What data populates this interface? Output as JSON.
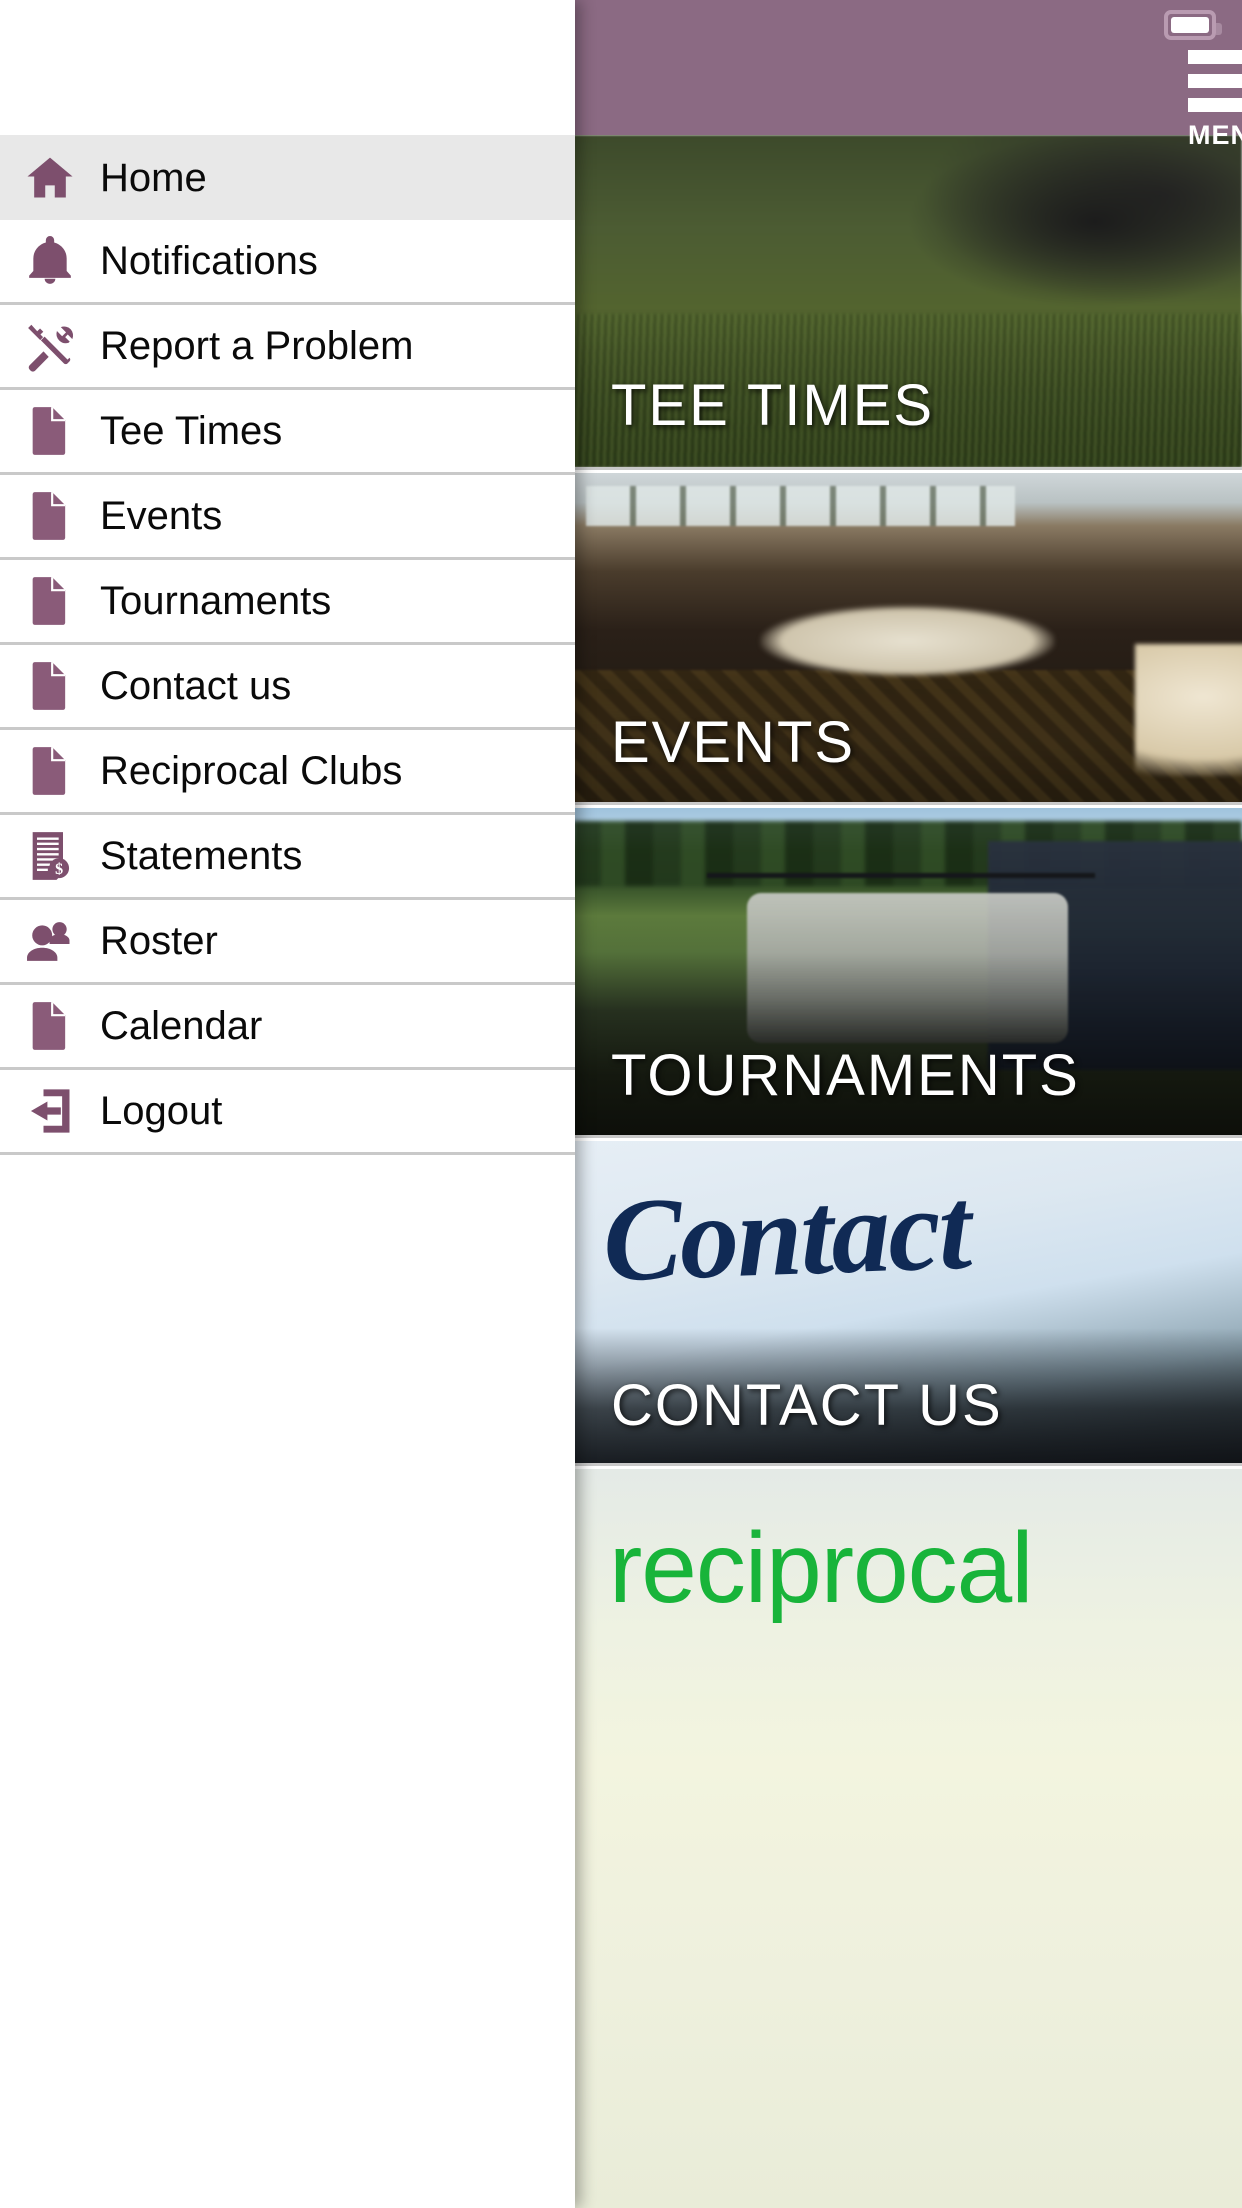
{
  "accent_color": "#8b6a83",
  "header": {
    "menu_label": "MENU",
    "hamburger_icon": "hamburger-menu-icon",
    "battery_icon": "battery-full-icon"
  },
  "drawer": {
    "items": [
      {
        "label": "Home",
        "icon": "home-icon",
        "active": true
      },
      {
        "label": "Notifications",
        "icon": "bell-icon",
        "active": false
      },
      {
        "label": "Report a Problem",
        "icon": "tools-icon",
        "active": false
      },
      {
        "label": "Tee Times",
        "icon": "document-icon",
        "active": false
      },
      {
        "label": "Events",
        "icon": "document-icon",
        "active": false
      },
      {
        "label": "Tournaments",
        "icon": "document-icon",
        "active": false
      },
      {
        "label": "Contact us",
        "icon": "document-icon",
        "active": false
      },
      {
        "label": "Reciprocal Clubs",
        "icon": "document-icon",
        "active": false
      },
      {
        "label": "Statements",
        "icon": "invoice-dollar-icon",
        "active": false
      },
      {
        "label": "Roster",
        "icon": "people-icon",
        "active": false
      },
      {
        "label": "Calendar",
        "icon": "document-icon",
        "active": false
      },
      {
        "label": "Logout",
        "icon": "logout-arrow-icon",
        "active": false
      }
    ]
  },
  "tiles": [
    {
      "label": "TEE TIMES",
      "name": "tile-tee-times"
    },
    {
      "label": "EVENTS",
      "name": "tile-events"
    },
    {
      "label": "TOURNAMENTS",
      "name": "tile-tournaments"
    },
    {
      "label": "CONTACT US",
      "name": "tile-contact-us"
    },
    {
      "label": "",
      "name": "tile-reciprocal"
    }
  ],
  "tile_art": {
    "contact_script_text": "Contact",
    "reciprocal_word": "reciprocal"
  }
}
